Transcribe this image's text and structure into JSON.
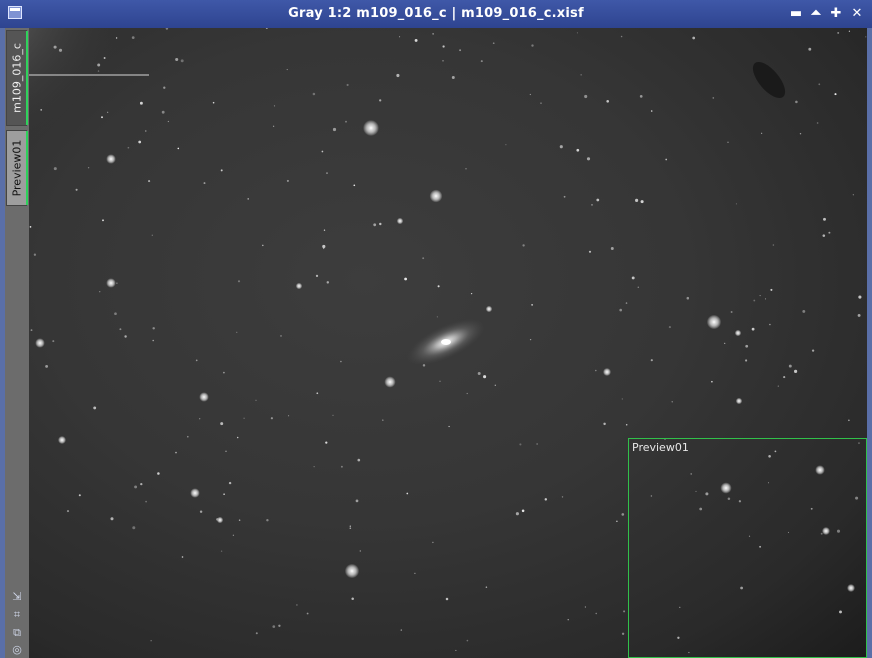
{
  "window": {
    "title": "Gray 1:2 m109_016_c | m109_016_c.xisf",
    "buttons": [
      "minimize",
      "shade",
      "maximize",
      "close"
    ],
    "accent_color": "#2fd25b"
  },
  "sidebar": {
    "tabs": [
      {
        "label": "m109_016_c",
        "active": true
      },
      {
        "label": "Preview01",
        "active": false
      }
    ],
    "tools": [
      "fit-view-icon",
      "zoom-fit-icon",
      "clone-icon",
      "mask-icon"
    ]
  },
  "image": {
    "preview": {
      "label": "Preview01"
    }
  }
}
